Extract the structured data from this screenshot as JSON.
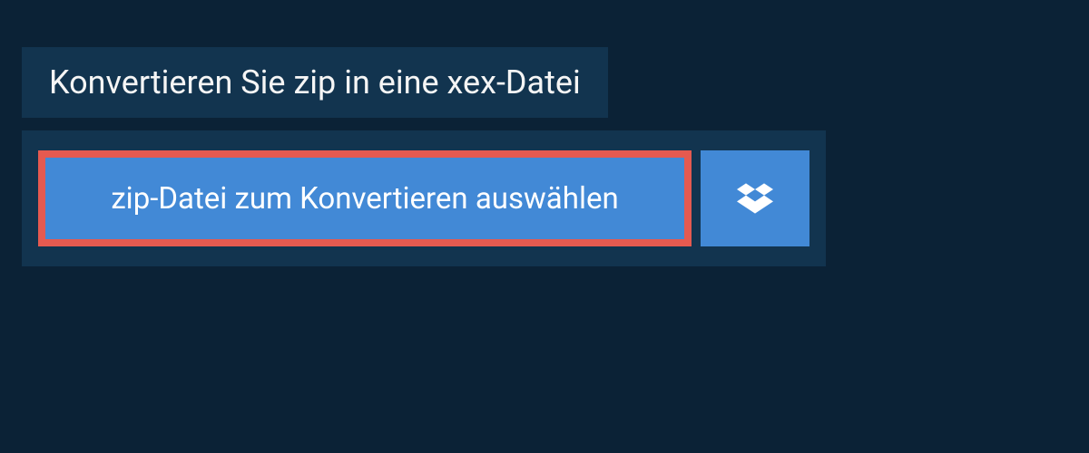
{
  "header": {
    "title": "Konvertieren Sie zip in eine xex-Datei"
  },
  "actions": {
    "select_file_label": "zip-Datei zum Konvertieren auswählen"
  },
  "colors": {
    "background": "#0b2236",
    "panel": "#12344f",
    "button": "#4289d6",
    "highlight_border": "#e55a50"
  }
}
